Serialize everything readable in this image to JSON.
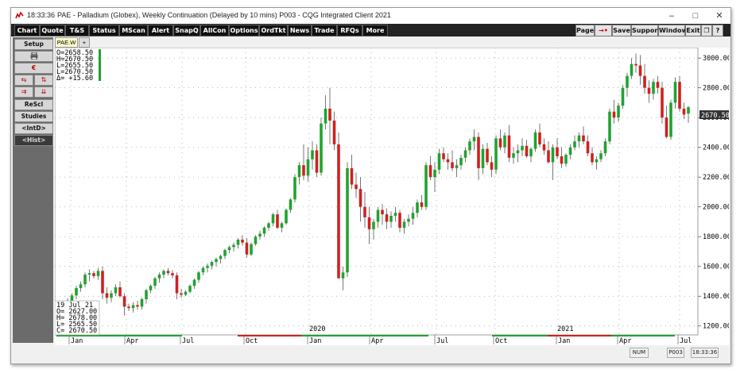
{
  "titlebar": {
    "time": "18:33:36",
    "title": "PAE - Palladium (Globex), Weekly Continuation (Delayed by 10 mins)   P003 - CQG Integrated Client 2021",
    "minimize": "–",
    "maximize": "□",
    "close": "✕"
  },
  "toolbar": {
    "left": [
      "Chart",
      "Quote",
      "T&S",
      "Status",
      "MScan",
      "Alert",
      "SnapQ",
      "AllCon",
      "Options",
      "OrdTkt",
      "News",
      "Trade",
      "RFQs",
      "More"
    ],
    "right": [
      "Page",
      "→•",
      "Save",
      "Support",
      "Window",
      "Exit",
      "❐",
      "?"
    ]
  },
  "sidebar": {
    "setup": "Setup",
    "print_icon": "printer-icon",
    "rescl": "ReScl",
    "studies": "Studies",
    "intd": "<IntD>",
    "hist": "<Hist>"
  },
  "tabs": {
    "active": "PAE.W",
    "add": "+"
  },
  "ohlc_top": {
    "o": "O=2658.50",
    "h": "H=2670.50",
    "l": "L=2655.50",
    "c": "L=2670.50",
    "d": "Δ= +15.60"
  },
  "ohlc_box": {
    "date": "19 Jul 21",
    "o": "O= 2627.00",
    "h": "H= 2678.00",
    "l": "L= 2565.50",
    "c": "C= 2670.50"
  },
  "price_label": "2670.50",
  "status": {
    "num": "NUM",
    "page": "P003",
    "time": "18:33:36"
  },
  "colors": {
    "up": "#1fa32e",
    "down": "#d11f1f",
    "wick": "#555555",
    "grid": "#9a9a9a"
  },
  "chart_data": {
    "type": "candlestick",
    "title": "PAE - Palladium (Globex), Weekly Continuation",
    "ylim": [
      1140,
      3070
    ],
    "yticks": [
      "3000.00",
      "2800.00",
      "2600.00",
      "2400.00",
      "2200.00",
      "2000.00",
      "1800.00",
      "1600.00",
      "1400.00",
      "1200.00"
    ],
    "ytick_values": [
      3000,
      2800,
      2600,
      2400,
      2200,
      2000,
      1800,
      1600,
      1400,
      1200
    ],
    "x_months": [
      "Jan",
      "Apr",
      "Jul",
      "Oct",
      "Jan",
      "Apr",
      "Jul",
      "Oct",
      "Jan",
      "Apr",
      "Jul"
    ],
    "x_years": [
      "2020",
      "2021"
    ],
    "candles": [
      [
        1325,
        1385,
        1290,
        1370
      ],
      [
        1370,
        1420,
        1350,
        1405
      ],
      [
        1405,
        1470,
        1380,
        1455
      ],
      [
        1455,
        1500,
        1430,
        1480
      ],
      [
        1480,
        1560,
        1460,
        1545
      ],
      [
        1545,
        1580,
        1500,
        1555
      ],
      [
        1555,
        1570,
        1520,
        1535
      ],
      [
        1535,
        1590,
        1510,
        1570
      ],
      [
        1570,
        1600,
        1380,
        1420
      ],
      [
        1420,
        1460,
        1350,
        1390
      ],
      [
        1390,
        1440,
        1360,
        1420
      ],
      [
        1420,
        1480,
        1400,
        1460
      ],
      [
        1460,
        1500,
        1390,
        1400
      ],
      [
        1400,
        1420,
        1270,
        1330
      ],
      [
        1330,
        1350,
        1300,
        1320
      ],
      [
        1320,
        1360,
        1290,
        1340
      ],
      [
        1340,
        1370,
        1310,
        1330
      ],
      [
        1330,
        1390,
        1310,
        1380
      ],
      [
        1380,
        1450,
        1350,
        1440
      ],
      [
        1440,
        1480,
        1420,
        1470
      ],
      [
        1470,
        1530,
        1450,
        1520
      ],
      [
        1520,
        1560,
        1490,
        1545
      ],
      [
        1545,
        1580,
        1520,
        1570
      ],
      [
        1570,
        1590,
        1540,
        1555
      ],
      [
        1555,
        1575,
        1520,
        1540
      ],
      [
        1540,
        1560,
        1380,
        1420
      ],
      [
        1420,
        1450,
        1390,
        1410
      ],
      [
        1410,
        1440,
        1400,
        1430
      ],
      [
        1430,
        1480,
        1420,
        1470
      ],
      [
        1470,
        1520,
        1450,
        1510
      ],
      [
        1510,
        1570,
        1490,
        1560
      ],
      [
        1560,
        1600,
        1540,
        1590
      ],
      [
        1590,
        1620,
        1560,
        1605
      ],
      [
        1605,
        1640,
        1580,
        1630
      ],
      [
        1630,
        1660,
        1600,
        1650
      ],
      [
        1650,
        1680,
        1620,
        1670
      ],
      [
        1670,
        1720,
        1650,
        1710
      ],
      [
        1710,
        1740,
        1690,
        1730
      ],
      [
        1730,
        1760,
        1700,
        1745
      ],
      [
        1745,
        1790,
        1720,
        1780
      ],
      [
        1780,
        1810,
        1740,
        1760
      ],
      [
        1760,
        1790,
        1660,
        1680
      ],
      [
        1680,
        1760,
        1670,
        1750
      ],
      [
        1750,
        1810,
        1740,
        1800
      ],
      [
        1800,
        1840,
        1780,
        1820
      ],
      [
        1820,
        1870,
        1800,
        1860
      ],
      [
        1860,
        1900,
        1840,
        1890
      ],
      [
        1890,
        1960,
        1870,
        1950
      ],
      [
        1950,
        1980,
        1850,
        1860
      ],
      [
        1860,
        1900,
        1830,
        1890
      ],
      [
        1890,
        1990,
        1880,
        1980
      ],
      [
        1980,
        2060,
        1960,
        2050
      ],
      [
        2050,
        2220,
        2030,
        2200
      ],
      [
        2200,
        2300,
        2150,
        2280
      ],
      [
        2280,
        2420,
        2180,
        2210
      ],
      [
        2210,
        2400,
        2170,
        2320
      ],
      [
        2320,
        2440,
        2250,
        2380
      ],
      [
        2380,
        2420,
        2200,
        2230
      ],
      [
        2230,
        2600,
        2210,
        2560
      ],
      [
        2560,
        2750,
        2520,
        2660
      ],
      [
        2660,
        2800,
        2420,
        2580
      ],
      [
        2580,
        2640,
        2380,
        2420
      ],
      [
        2420,
        2500,
        1540,
        1520
      ],
      [
        1520,
        1600,
        1440,
        1560
      ],
      [
        1560,
        2300,
        1530,
        2260
      ],
      [
        2260,
        2350,
        2120,
        2150
      ],
      [
        2150,
        2230,
        2060,
        2120
      ],
      [
        2120,
        2200,
        1900,
        2000
      ],
      [
        2000,
        2100,
        1860,
        1930
      ],
      [
        1930,
        2000,
        1750,
        1850
      ],
      [
        1850,
        1920,
        1780,
        1900
      ],
      [
        1900,
        2000,
        1860,
        1980
      ],
      [
        1980,
        2020,
        1880,
        1950
      ],
      [
        1950,
        1990,
        1850,
        1900
      ],
      [
        1900,
        1970,
        1860,
        1940
      ],
      [
        1940,
        2000,
        1900,
        1960
      ],
      [
        1960,
        1980,
        1830,
        1860
      ],
      [
        1860,
        1920,
        1820,
        1900
      ],
      [
        1900,
        1950,
        1870,
        1920
      ],
      [
        1920,
        2000,
        1880,
        1960
      ],
      [
        1960,
        2050,
        1930,
        2030
      ],
      [
        2030,
        2080,
        1980,
        2000
      ],
      [
        2000,
        2300,
        1980,
        2280
      ],
      [
        2280,
        2340,
        2180,
        2200
      ],
      [
        2200,
        2300,
        2100,
        2250
      ],
      [
        2250,
        2390,
        2220,
        2360
      ],
      [
        2360,
        2400,
        2300,
        2320
      ],
      [
        2320,
        2360,
        2250,
        2300
      ],
      [
        2300,
        2380,
        2240,
        2260
      ],
      [
        2260,
        2320,
        2200,
        2280
      ],
      [
        2280,
        2350,
        2250,
        2330
      ],
      [
        2330,
        2400,
        2300,
        2380
      ],
      [
        2380,
        2460,
        2350,
        2440
      ],
      [
        2440,
        2520,
        2380,
        2470
      ],
      [
        2470,
        2500,
        2180,
        2260
      ],
      [
        2260,
        2420,
        2220,
        2390
      ],
      [
        2390,
        2430,
        2280,
        2300
      ],
      [
        2300,
        2340,
        2200,
        2250
      ],
      [
        2250,
        2480,
        2220,
        2460
      ],
      [
        2460,
        2520,
        2380,
        2400
      ],
      [
        2400,
        2500,
        2360,
        2480
      ],
      [
        2480,
        2550,
        2300,
        2330
      ],
      [
        2330,
        2400,
        2290,
        2360
      ],
      [
        2360,
        2420,
        2300,
        2380
      ],
      [
        2380,
        2460,
        2340,
        2410
      ],
      [
        2410,
        2450,
        2330,
        2340
      ],
      [
        2340,
        2400,
        2300,
        2390
      ],
      [
        2390,
        2520,
        2370,
        2500
      ],
      [
        2500,
        2560,
        2400,
        2420
      ],
      [
        2420,
        2460,
        2350,
        2380
      ],
      [
        2380,
        2440,
        2290,
        2300
      ],
      [
        2300,
        2420,
        2180,
        2400
      ],
      [
        2400,
        2460,
        2320,
        2340
      ],
      [
        2340,
        2400,
        2260,
        2290
      ],
      [
        2290,
        2360,
        2270,
        2350
      ],
      [
        2350,
        2420,
        2320,
        2400
      ],
      [
        2400,
        2480,
        2380,
        2440
      ],
      [
        2440,
        2500,
        2400,
        2480
      ],
      [
        2480,
        2540,
        2420,
        2440
      ],
      [
        2440,
        2480,
        2340,
        2360
      ],
      [
        2360,
        2400,
        2280,
        2300
      ],
      [
        2300,
        2340,
        2250,
        2320
      ],
      [
        2320,
        2380,
        2300,
        2360
      ],
      [
        2360,
        2460,
        2340,
        2440
      ],
      [
        2440,
        2660,
        2420,
        2640
      ],
      [
        2640,
        2720,
        2560,
        2600
      ],
      [
        2600,
        2700,
        2570,
        2680
      ],
      [
        2680,
        2820,
        2660,
        2800
      ],
      [
        2800,
        2900,
        2740,
        2880
      ],
      [
        2880,
        3000,
        2860,
        2960
      ],
      [
        2960,
        3030,
        2900,
        2950
      ],
      [
        2950,
        3020,
        2820,
        2880
      ],
      [
        2880,
        2960,
        2760,
        2800
      ],
      [
        2800,
        2850,
        2700,
        2760
      ],
      [
        2760,
        2860,
        2720,
        2840
      ],
      [
        2840,
        2880,
        2760,
        2800
      ],
      [
        2800,
        2840,
        2560,
        2600
      ],
      [
        2600,
        2680,
        2460,
        2470
      ],
      [
        2470,
        2720,
        2450,
        2700
      ],
      [
        2700,
        2870,
        2660,
        2840
      ],
      [
        2840,
        2880,
        2640,
        2660
      ],
      [
        2660,
        2700,
        2590,
        2620
      ],
      [
        2627,
        2678,
        2565,
        2670
      ]
    ]
  }
}
